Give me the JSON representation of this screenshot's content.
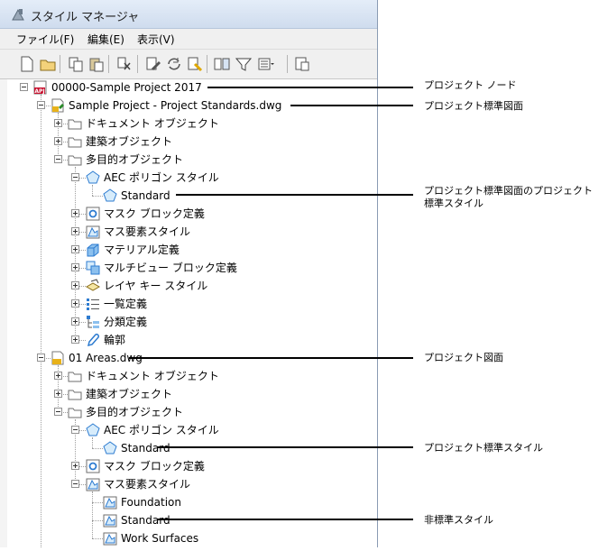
{
  "window": {
    "title": "スタイル マネージャ"
  },
  "menu": [
    {
      "label": "ファイル(F)"
    },
    {
      "label": "編集(E)"
    },
    {
      "label": "表示(V)"
    }
  ],
  "toolbar": [
    {
      "name": "new-icon"
    },
    {
      "name": "open-icon"
    },
    {
      "name": "copy-icon"
    },
    {
      "name": "paste-icon"
    },
    {
      "name": "purge-icon"
    },
    {
      "name": "edit-style-icon"
    },
    {
      "name": "synchronize-icon"
    },
    {
      "name": "clean-icon"
    },
    {
      "name": "toggle-view-icon"
    },
    {
      "name": "filter-icon"
    },
    {
      "name": "view-options-icon"
    },
    {
      "name": "help-icon"
    }
  ],
  "tree": [
    {
      "label": "00000-Sample Project 2017",
      "icon": "project-icon"
    },
    {
      "label": "Sample Project - Project Standards.dwg",
      "icon": "standards-drawing-icon"
    },
    {
      "label": "ドキュメント オブジェクト",
      "icon": "folder-icon"
    },
    {
      "label": "建築オブジェクト",
      "icon": "folder-icon"
    },
    {
      "label": "多目的オブジェクト",
      "icon": "folder-icon"
    },
    {
      "label": "AEC ポリゴン スタイル",
      "icon": "polygon-icon"
    },
    {
      "label": "Standard",
      "icon": "polygon-icon"
    },
    {
      "label": "マスク ブロック定義",
      "icon": "mask-block-icon"
    },
    {
      "label": "マス要素スタイル",
      "icon": "mass-element-icon"
    },
    {
      "label": "マテリアル定義",
      "icon": "material-icon"
    },
    {
      "label": "マルチビュー ブロック定義",
      "icon": "multiview-block-icon"
    },
    {
      "label": "レイヤ キー スタイル",
      "icon": "layer-key-icon"
    },
    {
      "label": "一覧定義",
      "icon": "list-definition-icon"
    },
    {
      "label": "分類定義",
      "icon": "classification-icon"
    },
    {
      "label": "輪郭",
      "icon": "profile-icon"
    },
    {
      "label": "01 Areas.dwg",
      "icon": "drawing-icon"
    },
    {
      "label": "ドキュメント オブジェクト",
      "icon": "folder-icon"
    },
    {
      "label": "建築オブジェクト",
      "icon": "folder-icon"
    },
    {
      "label": "多目的オブジェクト",
      "icon": "folder-icon"
    },
    {
      "label": "AEC ポリゴン スタイル",
      "icon": "polygon-icon"
    },
    {
      "label": "Standard",
      "icon": "polygon-icon"
    },
    {
      "label": "マスク ブロック定義",
      "icon": "mask-block-icon"
    },
    {
      "label": "マス要素スタイル",
      "icon": "mass-element-icon"
    },
    {
      "label": "Foundation",
      "icon": "mass-element-icon"
    },
    {
      "label": "Standard",
      "icon": "mass-element-icon"
    },
    {
      "label": "Work Surfaces",
      "icon": "mass-element-icon"
    }
  ],
  "callouts": [
    {
      "text": "プロジェクト ノード"
    },
    {
      "text": "プロジェクト標準図面"
    },
    {
      "text": "プロジェクト標準図面のプロジェクト\n標準スタイル"
    },
    {
      "text": "プロジェクト図面"
    },
    {
      "text": "プロジェクト標準スタイル"
    },
    {
      "text": "非標準スタイル"
    }
  ],
  "colors": {
    "accent": "#2d7bd0",
    "icon_gray": "#8a8a8a",
    "project_red": "#c8102e",
    "gold": "#e8b21a"
  }
}
